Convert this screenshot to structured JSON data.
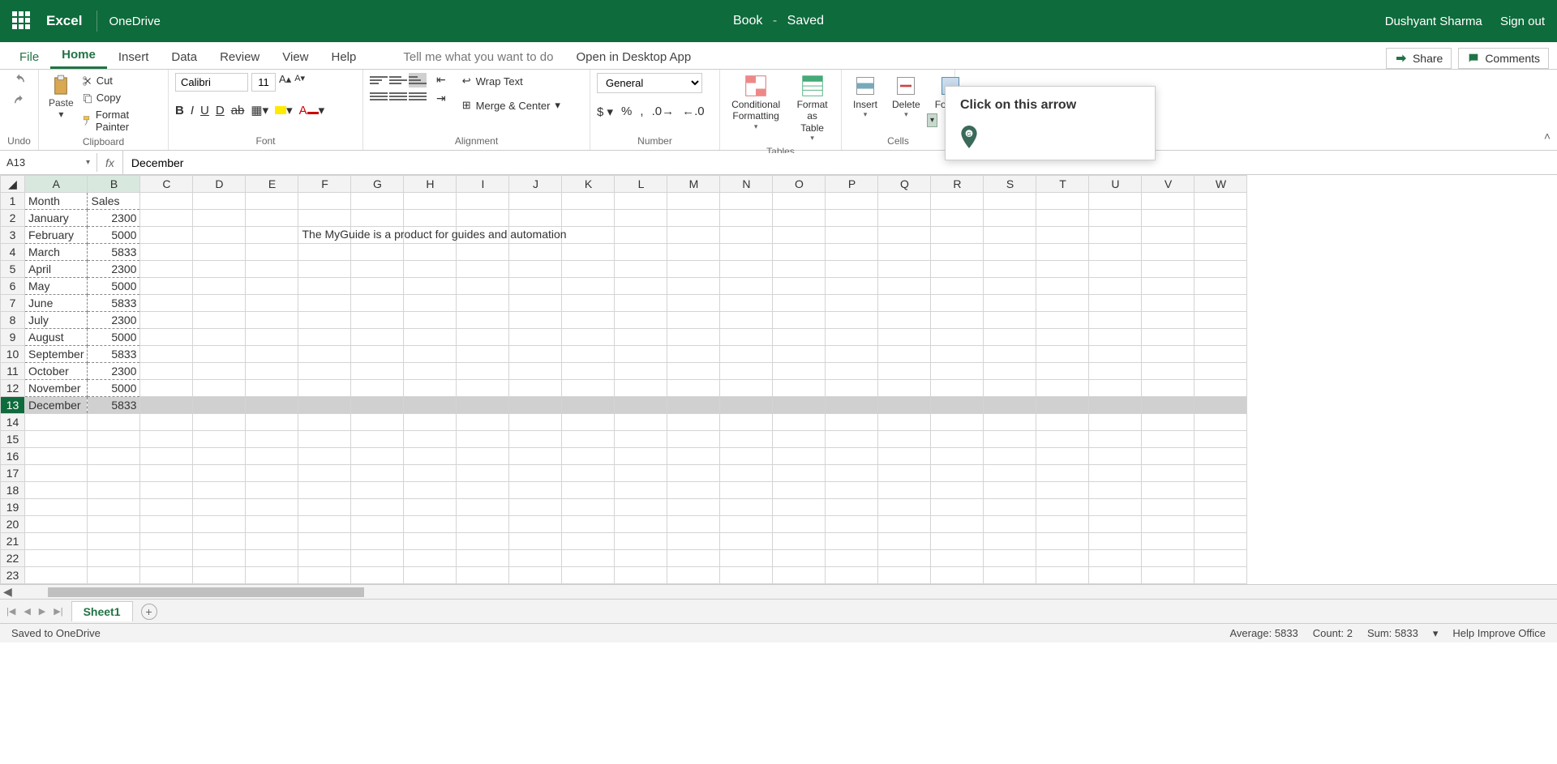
{
  "titlebar": {
    "app_name": "Excel",
    "storage": "OneDrive",
    "doc_name": "Book",
    "save_state": "Saved",
    "user": "Dushyant Sharma",
    "signout": "Sign out"
  },
  "menu": {
    "file": "File",
    "home": "Home",
    "insert": "Insert",
    "data": "Data",
    "review": "Review",
    "view": "View",
    "help": "Help",
    "tellme": "Tell me what you want to do",
    "desktop": "Open in Desktop App",
    "share": "Share",
    "comments": "Comments"
  },
  "ribbon": {
    "undo_label": "Undo",
    "clipboard": {
      "paste": "Paste",
      "cut": "Cut",
      "copy": "Copy",
      "painter": "Format Painter",
      "label": "Clipboard"
    },
    "font": {
      "name": "Calibri",
      "size": "11",
      "label": "Font"
    },
    "alignment": {
      "wrap": "Wrap Text",
      "merge": "Merge & Center",
      "label": "Alignment"
    },
    "number": {
      "format": "General",
      "label": "Number"
    },
    "tables": {
      "cond": "Conditional Formatting",
      "asTable": "Format as Table",
      "label": "Tables"
    },
    "cells": {
      "insert": "Insert",
      "delete": "Delete",
      "format": "Format",
      "label": "Cells"
    }
  },
  "tooltip": {
    "text": "Click on this arrow"
  },
  "namebox": "A13",
  "formula": "December",
  "columns": [
    "A",
    "B",
    "C",
    "D",
    "E",
    "F",
    "G",
    "H",
    "I",
    "J",
    "K",
    "L",
    "M",
    "N",
    "O",
    "P",
    "Q",
    "R",
    "S",
    "T",
    "U",
    "V",
    "W"
  ],
  "rows_shown": 23,
  "selected_row": 13,
  "chart_data": {
    "type": "table",
    "headers": [
      "Month",
      "Sales"
    ],
    "rows": [
      [
        "January",
        2300
      ],
      [
        "February",
        5000
      ],
      [
        "March",
        5833
      ],
      [
        "April",
        2300
      ],
      [
        "May",
        5000
      ],
      [
        "June",
        5833
      ],
      [
        "July",
        2300
      ],
      [
        "August",
        5000
      ],
      [
        "September",
        5833
      ],
      [
        "October",
        2300
      ],
      [
        "November",
        5000
      ],
      [
        "December",
        5833
      ]
    ],
    "floating_text": {
      "cell": "F3",
      "value": "The MyGuide is a product for guides and automation"
    }
  },
  "sheet_tab": "Sheet1",
  "statusbar": {
    "saved": "Saved to OneDrive",
    "average": "Average: 5833",
    "count": "Count: 2",
    "sum": "Sum: 5833",
    "help": "Help Improve Office"
  }
}
